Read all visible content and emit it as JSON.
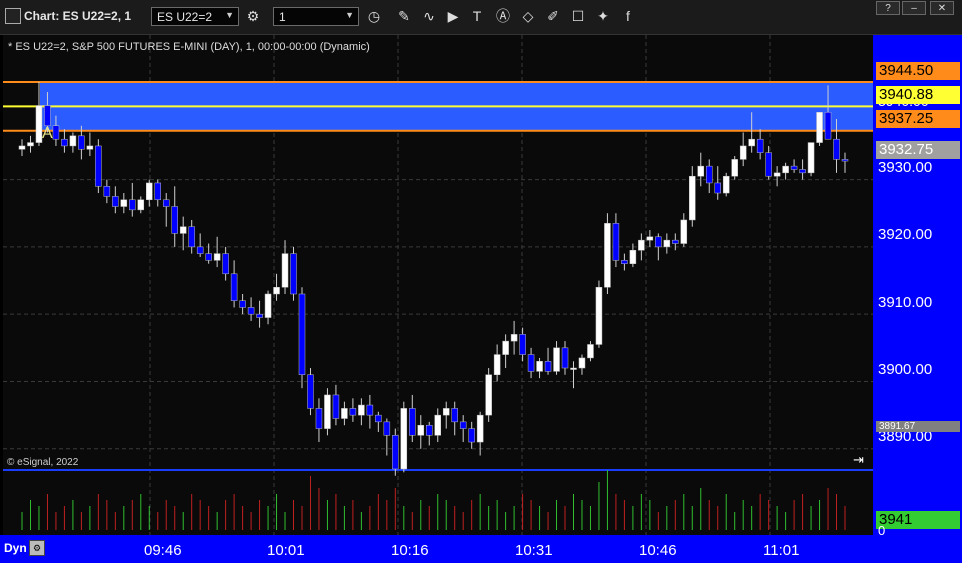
{
  "window": {
    "title": "Chart: ES U22=2, 1"
  },
  "toolbar": {
    "symbol": "ES U22=2",
    "interval": "1"
  },
  "chart": {
    "header": "* ES U22=2, S&P 500 FUTURES E-MINI (DAY), 1, 00:00-00:00 (Dynamic)",
    "copyright": "© eSignal, 2022",
    "label_a": "A",
    "y_ticks": [
      "3930.00",
      "3920.00",
      "3910.00",
      "3900.00",
      "3890.00"
    ],
    "x_ticks": [
      "09:46",
      "10:01",
      "10:16",
      "10:31",
      "10:46",
      "11:01"
    ],
    "price_tags": {
      "upper": "3944.50",
      "middle": "3940.88",
      "lower": "3937.25",
      "last": "3932.75",
      "hidden": "3940.00",
      "small": "3891.67"
    },
    "volume_tag": "3941",
    "volume_zero": "0",
    "dyn_label": "Dyn",
    "colors": {
      "up": "#ffffff",
      "down": "#0000ff",
      "band": "#2a5cff",
      "orange": "#ff8c1a",
      "yellow": "#ffff33"
    }
  },
  "chart_data": {
    "type": "candlestick",
    "x": [
      "09:46",
      "10:01",
      "10:16",
      "10:31",
      "10:46",
      "11:01"
    ],
    "ylim": [
      3885,
      3948
    ],
    "upper_line": 3944.5,
    "middle_line": 3940.88,
    "lower_line": 3937.25,
    "last_price": 3932.75,
    "candles": [
      [
        3934.5,
        3936.0,
        3933.5,
        3935.0
      ],
      [
        3935.0,
        3936.5,
        3934.0,
        3935.5
      ],
      [
        3935.5,
        3944.5,
        3935.0,
        3941.0
      ],
      [
        3941.0,
        3943.0,
        3937.0,
        3938.0
      ],
      [
        3938.0,
        3939.5,
        3935.0,
        3936.0
      ],
      [
        3936.0,
        3937.5,
        3934.0,
        3935.0
      ],
      [
        3935.0,
        3937.0,
        3934.0,
        3936.5
      ],
      [
        3936.5,
        3938.0,
        3933.0,
        3934.5
      ],
      [
        3934.5,
        3937.0,
        3933.5,
        3935.0
      ],
      [
        3935.0,
        3936.0,
        3928.0,
        3929.0
      ],
      [
        3929.0,
        3930.0,
        3926.5,
        3927.5
      ],
      [
        3927.5,
        3929.0,
        3925.0,
        3926.0
      ],
      [
        3926.0,
        3928.0,
        3925.0,
        3927.0
      ],
      [
        3927.0,
        3929.5,
        3924.5,
        3925.5
      ],
      [
        3925.5,
        3927.5,
        3925.0,
        3927.0
      ],
      [
        3927.0,
        3930.0,
        3926.0,
        3929.5
      ],
      [
        3929.5,
        3930.0,
        3926.0,
        3927.0
      ],
      [
        3927.0,
        3928.0,
        3923.0,
        3926.0
      ],
      [
        3926.0,
        3929.0,
        3920.0,
        3922.0
      ],
      [
        3922.0,
        3924.5,
        3919.5,
        3923.0
      ],
      [
        3923.0,
        3924.0,
        3919.0,
        3920.0
      ],
      [
        3920.0,
        3922.0,
        3918.5,
        3919.0
      ],
      [
        3919.0,
        3920.5,
        3917.5,
        3918.0
      ],
      [
        3918.0,
        3921.5,
        3917.0,
        3919.0
      ],
      [
        3919.0,
        3920.0,
        3915.0,
        3916.0
      ],
      [
        3916.0,
        3918.0,
        3911.0,
        3912.0
      ],
      [
        3912.0,
        3913.0,
        3910.0,
        3911.0
      ],
      [
        3911.0,
        3912.5,
        3909.0,
        3910.0
      ],
      [
        3910.0,
        3912.0,
        3908.0,
        3909.5
      ],
      [
        3909.5,
        3913.5,
        3908.5,
        3913.0
      ],
      [
        3913.0,
        3916.0,
        3912.0,
        3914.0
      ],
      [
        3914.0,
        3921.0,
        3913.0,
        3919.0
      ],
      [
        3919.0,
        3920.0,
        3912.0,
        3913.0
      ],
      [
        3913.0,
        3914.0,
        3899.0,
        3901.0
      ],
      [
        3901.0,
        3902.0,
        3895.0,
        3896.0
      ],
      [
        3896.0,
        3897.5,
        3891.0,
        3893.0
      ],
      [
        3893.0,
        3899.0,
        3892.0,
        3898.0
      ],
      [
        3898.0,
        3899.5,
        3893.5,
        3894.5
      ],
      [
        3894.5,
        3897.0,
        3893.5,
        3896.0
      ],
      [
        3896.0,
        3897.5,
        3894.0,
        3895.0
      ],
      [
        3895.0,
        3897.5,
        3893.5,
        3896.5
      ],
      [
        3896.5,
        3898.0,
        3893.0,
        3895.0
      ],
      [
        3895.0,
        3895.5,
        3892.5,
        3894.0
      ],
      [
        3894.0,
        3894.5,
        3889.0,
        3892.0
      ],
      [
        3892.0,
        3893.0,
        3886.0,
        3887.0
      ],
      [
        3887.0,
        3897.0,
        3886.5,
        3896.0
      ],
      [
        3896.0,
        3898.0,
        3891.0,
        3892.0
      ],
      [
        3892.0,
        3895.0,
        3890.0,
        3893.5
      ],
      [
        3893.5,
        3894.0,
        3890.5,
        3892.0
      ],
      [
        3892.0,
        3896.0,
        3891.0,
        3895.0
      ],
      [
        3895.0,
        3897.0,
        3893.0,
        3896.0
      ],
      [
        3896.0,
        3897.0,
        3892.0,
        3894.0
      ],
      [
        3894.0,
        3895.0,
        3891.0,
        3893.0
      ],
      [
        3893.0,
        3894.0,
        3890.0,
        3891.0
      ],
      [
        3891.0,
        3895.5,
        3889.0,
        3895.0
      ],
      [
        3895.0,
        3902.0,
        3894.0,
        3901.0
      ],
      [
        3901.0,
        3905.5,
        3900.0,
        3904.0
      ],
      [
        3904.0,
        3907.0,
        3902.0,
        3906.0
      ],
      [
        3906.0,
        3909.0,
        3904.0,
        3907.0
      ],
      [
        3907.0,
        3908.0,
        3903.0,
        3904.0
      ],
      [
        3904.0,
        3905.0,
        3900.5,
        3901.5
      ],
      [
        3901.5,
        3903.5,
        3900.5,
        3903.0
      ],
      [
        3903.0,
        3905.0,
        3901.0,
        3901.5
      ],
      [
        3901.5,
        3906.0,
        3901.0,
        3905.0
      ],
      [
        3905.0,
        3906.0,
        3901.0,
        3902.0
      ],
      [
        3902.0,
        3903.0,
        3899.0,
        3902.0
      ],
      [
        3902.0,
        3904.0,
        3901.0,
        3903.5
      ],
      [
        3903.5,
        3906.0,
        3903.0,
        3905.5
      ],
      [
        3905.5,
        3915.0,
        3905.0,
        3914.0
      ],
      [
        3914.0,
        3925.0,
        3913.0,
        3923.5
      ],
      [
        3923.5,
        3925.0,
        3917.0,
        3918.0
      ],
      [
        3918.0,
        3919.0,
        3916.5,
        3917.5
      ],
      [
        3917.5,
        3920.5,
        3917.0,
        3919.5
      ],
      [
        3919.5,
        3922.0,
        3918.0,
        3921.0
      ],
      [
        3921.0,
        3922.5,
        3920.0,
        3921.5
      ],
      [
        3921.5,
        3922.0,
        3918.0,
        3920.0
      ],
      [
        3920.0,
        3922.0,
        3919.0,
        3921.0
      ],
      [
        3921.0,
        3922.0,
        3919.5,
        3920.5
      ],
      [
        3920.5,
        3925.0,
        3920.0,
        3924.0
      ],
      [
        3924.0,
        3932.0,
        3923.0,
        3930.5
      ],
      [
        3930.5,
        3934.0,
        3929.0,
        3932.0
      ],
      [
        3932.0,
        3933.0,
        3928.0,
        3929.5
      ],
      [
        3929.5,
        3932.0,
        3927.0,
        3928.0
      ],
      [
        3928.0,
        3931.0,
        3927.5,
        3930.5
      ],
      [
        3930.5,
        3933.5,
        3930.0,
        3933.0
      ],
      [
        3933.0,
        3937.0,
        3932.0,
        3935.0
      ],
      [
        3935.0,
        3940.0,
        3934.0,
        3936.0
      ],
      [
        3936.0,
        3937.5,
        3933.0,
        3934.0
      ],
      [
        3934.0,
        3935.0,
        3930.0,
        3930.5
      ],
      [
        3930.5,
        3932.0,
        3929.0,
        3931.0
      ],
      [
        3931.0,
        3932.5,
        3930.0,
        3932.0
      ],
      [
        3932.0,
        3933.0,
        3931.0,
        3931.5
      ],
      [
        3931.5,
        3933.0,
        3930.0,
        3931.0
      ],
      [
        3931.0,
        3934.0,
        3930.5,
        3935.5
      ],
      [
        3935.5,
        3940.0,
        3935.0,
        3940.0
      ],
      [
        3940.0,
        3944.0,
        3937.0,
        3936.0
      ],
      [
        3936.0,
        3939.0,
        3931.0,
        3933.0
      ],
      [
        3933.0,
        3934.0,
        3931.0,
        3932.75
      ]
    ],
    "volume": [
      3,
      5,
      4,
      6,
      3,
      4,
      5,
      3,
      4,
      6,
      5,
      3,
      4,
      5,
      6,
      4,
      3,
      5,
      4,
      3,
      6,
      5,
      4,
      3,
      5,
      6,
      4,
      3,
      5,
      4,
      6,
      3,
      5,
      4,
      9,
      7,
      5,
      6,
      4,
      5,
      3,
      4,
      6,
      5,
      7,
      4,
      3,
      5,
      4,
      6,
      5,
      4,
      3,
      5,
      6,
      4,
      5,
      3,
      4,
      6,
      5,
      4,
      3,
      5,
      4,
      6,
      5,
      4,
      8,
      10,
      6,
      5,
      4,
      6,
      5,
      3,
      4,
      5,
      6,
      4,
      7,
      5,
      4,
      6,
      3,
      5,
      4,
      6,
      5,
      4,
      3,
      5,
      6,
      4,
      5,
      7,
      6,
      4
    ]
  }
}
